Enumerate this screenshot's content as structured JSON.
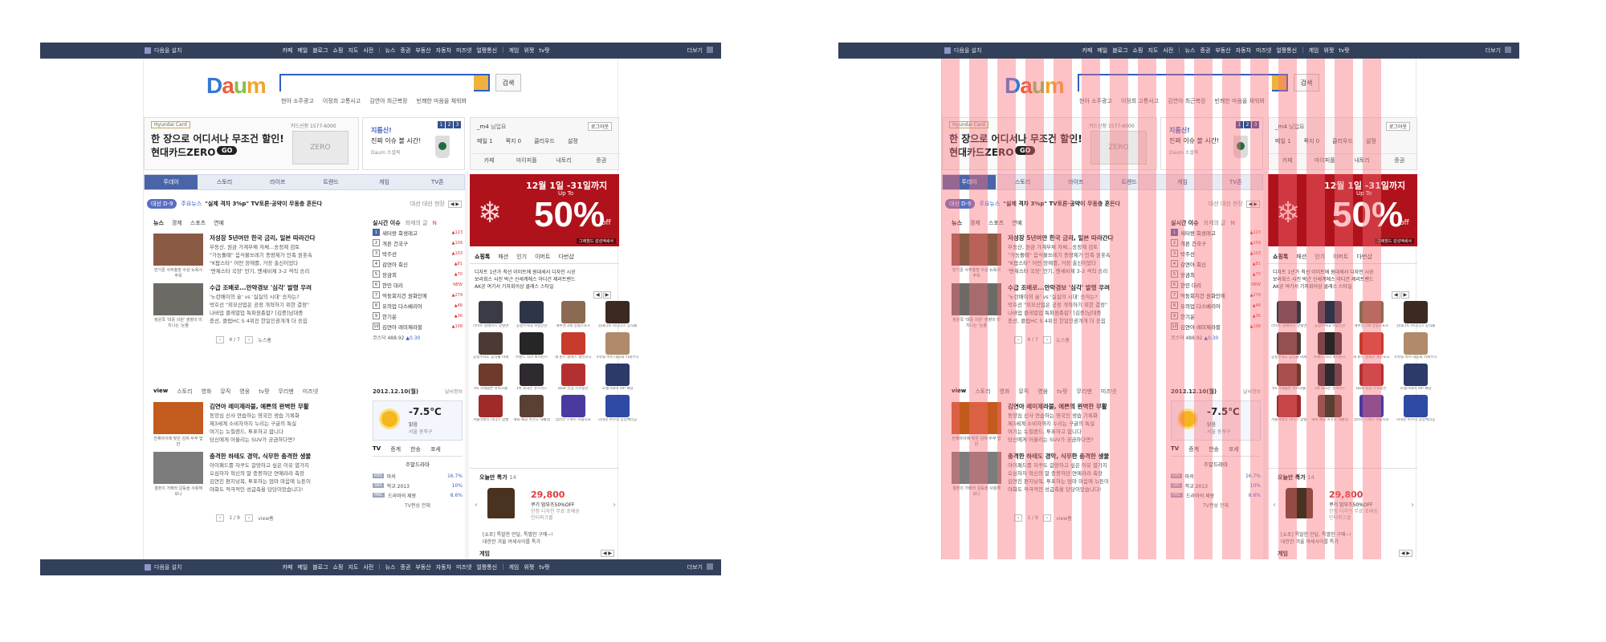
{
  "top_bar": {
    "login_label": "다음을 설치",
    "links": [
      "카페",
      "메일",
      "블로그",
      "쇼핑",
      "지도",
      "사전",
      "뉴스",
      "증권",
      "부동산",
      "자동차",
      "미즈넷",
      "얼짱통신"
    ],
    "right_links": [
      "게임",
      "위젯",
      "tv팟"
    ],
    "more_label": "더보기"
  },
  "logo": {
    "text": "Daum"
  },
  "search": {
    "placeholder": "",
    "button_label": "검색"
  },
  "trending": [
    "현아 소주광고",
    "이정희 고통사고",
    "김연아 최근복장",
    "빈쾌한 마음을 채워봐"
  ],
  "banner": {
    "tag": "Hyundai Card",
    "line1": "한 장으로 어디서나 무조건 할인!",
    "line2": "현대카드ZERO",
    "go_label": "GO",
    "phone": "카드신청 1577-6000",
    "card_text": "ZERO"
  },
  "promo": {
    "line1": "지름신!",
    "line2": "진짜 이슈 볼 시간!",
    "line3": "Daum 소셜픽",
    "pager": [
      "1",
      "2",
      "3"
    ]
  },
  "login_box": {
    "user": "_m4",
    "user_suffix": "님입요",
    "logout_label": "로그아웃",
    "row2": [
      "메일 1",
      "쪽지 0",
      "클리우드",
      "설정"
    ],
    "row3": [
      "카페",
      "마이피플",
      "내토리",
      "증권"
    ]
  },
  "nav_tabs": [
    "투데이",
    "스토리",
    "라이프",
    "트렌드",
    "게임",
    "TV존"
  ],
  "ticker": {
    "badge": "대선 D-9",
    "source": "주요뉴스",
    "headline": "\"실제 격차 3%p\" TV토론·공약이 무동층 흔든다",
    "more": "대선 대선 현장"
  },
  "news": {
    "tabs": [
      "뉴스",
      "경제",
      "스포츠",
      "연예"
    ],
    "items": [
      {
        "title": "저성장 5년여만 한국 금리, 일본 따라간다",
        "lines": [
          "부동산, 원금 가계부채 자체...송정제 검토",
          "\"가능돌때\" 음식물쓰레기 종량제가 민족 원훗속",
          "\"K팝스타\" 어떤 장애를, 거장 출신이었다",
          "'면제스타 국장' 만기, 멘세비제 3-2 격직 승리"
        ],
        "caption": "반기문 사무총장 수상\n뉴욕서 주목"
      },
      {
        "title": "수급 조배로...안약경보 '심각' 발령 우려",
        "lines": [
          "'노란배이의 술' vs '실실의 시대' 승자는?",
          "박호선 \"외모산업은 공정 개혁하기 위한 결정\"",
          "나바업 클레멀업 특파원총합? [김중]남대중",
          "충선, 클럽HC S 4위진 한일인권개개 더 응읍"
        ],
        "caption": "정운쪽 '대중 의원'\n영향의 미치니는 '눈물"
      }
    ],
    "pager": "4 / 7",
    "more": "뉴스홈"
  },
  "realtime": {
    "title": "실시간 이슈",
    "sub": "화제의 글",
    "badge": "N",
    "items": [
      "새터랑 회생래고",
      "개른 건국구",
      "박주선",
      "감연아 회신",
      "장금최",
      "한민 대리",
      "억둥회지건 원화인에",
      "유의업 다스베리어",
      "한기운",
      "김연아 레미제라블"
    ],
    "values": [
      "▲123",
      "▲109",
      "▲103",
      "▲81",
      "▲70",
      "NEW",
      "▲279",
      "▲48",
      "▲36",
      "▲108"
    ],
    "stock": "코스닥 488.92",
    "stock_change": "▲0.30"
  },
  "view": {
    "tabs": [
      "view",
      "스토리",
      "영화",
      "뮤직",
      "영웅",
      "tv팟",
      "무리맨",
      "미즈넷",
      "미즈넷"
    ],
    "items": [
      {
        "title": "김연아 레미제라블, 예쁜의 완벽한 무활",
        "lines": [
          "동양심 신사 연습하는 영국인 생습 기록화",
          "제3세계 소비자까지 누리는 구글의 특실",
          "여기는 뉴질랜드, 투표하고 합니다",
          "당신에게 어울리는 SUV가 궁금하다면?"
        ],
        "caption": "전체아이에 맞은\n감자·두부 밥반"
      },
      {
        "title": "충격한 하테도 경악, 식무한 충격한 생물",
        "lines": [
          "아이패드를 자꾸도 갈망하고 싶은 이유 열가지",
          "오심하자 혁신의 말 충봉하던 연예라라 축장",
          "김연진 편지낭목, 투표하는 엄마 마음에 뉴튼이",
          "야화도 적극적인 성급측을 당당이었습니다!"
        ],
        "caption": "결혼이 가배라\n갈등을 사용해보니"
      }
    ],
    "pager": "1 / 9",
    "more": "view홈"
  },
  "weather": {
    "date": "2012.12.10(월)",
    "more": "날씨정보",
    "temp": "-7.5℃",
    "cond": "맑음",
    "location": "서울 동작구",
    "tv_tabs": [
      "TV",
      "증계",
      "한송",
      "포세"
    ],
    "tv_subtitle": "주말드라마",
    "tv_rows": [
      {
        "k": "KBS",
        "name": "마의",
        "pct": "16.7%"
      },
      {
        "k": "SBS",
        "name": "학교 2013",
        "pct": "10%"
      },
      {
        "k": "MBC",
        "name": "드라마의 제왕",
        "pct": "8.6%"
      }
    ],
    "tv_more": "TV편성 전체"
  },
  "ad": {
    "date": "12월 1일 -31일까지",
    "upto": "Up To",
    "pct": "50%",
    "off": "off",
    "footer": "그레힐드 감성액세서"
  },
  "shopping": {
    "tabs": [
      "쇼핑톡",
      "패션",
      "인기",
      "이머트",
      "다번샵"
    ],
    "news": [
      "디자트 1년가 칙선 이미트에 원대세서 디자인 시공",
      "보라회스 사진 박근 신세계에스 아디건 제리트렌드",
      "AK공 여기서 기자회이상 클래스 스타일"
    ],
    "products": [
      "라이트 원레이스 양털면",
      "공정부사대 학령인찬",
      "해누엔 2팩 양털스포츠",
      "김대다토 아디다스 공식몰",
      "공정부사도 공식몰 야세",
      "브랜드 자라 바이런스",
      "해 윈드 원래스 세신모디",
      "V유틸 아이 대동화 카레부다",
      "VS 가세블론 아이크롤",
      "1위 외국은 슈즈리드",
      "Best 신상 스프링만",
      "모델가데이 VIP 패딩",
      "겨울어밴리 아더스 맞벌",
      "해외 패딩 아웃도 대통령",
      "엄마한 스위트 이블리포",
      "나대문 아우리 당망체리공"
    ],
    "special_title": "오늘만 특가",
    "special_count": "14",
    "price": "29,800",
    "desc1": "쿠기 맘부츠50%OFF",
    "desc2": "한정 디자인 무료 초배송",
    "desc3": "인터파크몰",
    "extra1": "[쇼포] 특발한 안달, 특별한 구매~!",
    "extra2": "대한한 겨울 여세사이를 특가"
  },
  "game": {
    "title": "게임",
    "count": "14"
  },
  "colors": {
    "top_bar": "#33405a",
    "accent": "#4a64a8",
    "ad_red": "#b0121b",
    "overlay": "#fa6e78"
  }
}
